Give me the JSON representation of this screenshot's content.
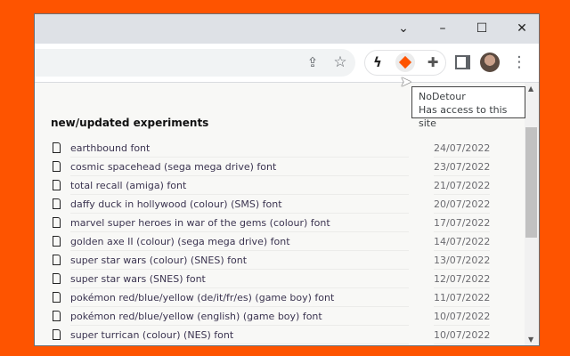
{
  "window": {
    "controls": {
      "tabsearch": "⌄",
      "minimize": "–",
      "maximize": "☐",
      "close": "✕"
    }
  },
  "toolbar": {
    "share": "⇪",
    "star": "☆",
    "bolt": "ϟ",
    "puzzle": "✚",
    "more": "⋮"
  },
  "tooltip": {
    "title": "NoDetour",
    "subtitle": "Has access to this site"
  },
  "heading": "new/updated experiments",
  "items": [
    {
      "title": "earthbound font",
      "date": "24/07/2022"
    },
    {
      "title": "cosmic spacehead (sega mega drive) font",
      "date": "23/07/2022"
    },
    {
      "title": "total recall (amiga) font",
      "date": "21/07/2022"
    },
    {
      "title": "daffy duck in hollywood (colour) (SMS) font",
      "date": "20/07/2022"
    },
    {
      "title": "marvel super heroes in war of the gems (colour) font",
      "date": "17/07/2022"
    },
    {
      "title": "golden axe II (colour) (sega mega drive) font",
      "date": "14/07/2022"
    },
    {
      "title": "super star wars (colour) (SNES) font",
      "date": "13/07/2022"
    },
    {
      "title": "super star wars (SNES) font",
      "date": "12/07/2022"
    },
    {
      "title": "pokémon red/blue/yellow (de/it/fr/es) (game boy) font",
      "date": "11/07/2022"
    },
    {
      "title": "pokémon red/blue/yellow (english) (game boy) font",
      "date": "10/07/2022"
    },
    {
      "title": "super turrican (colour) (NES) font",
      "date": "10/07/2022"
    }
  ],
  "colors": {
    "background": "#fe5400",
    "extension_accent": "#fe5400"
  }
}
